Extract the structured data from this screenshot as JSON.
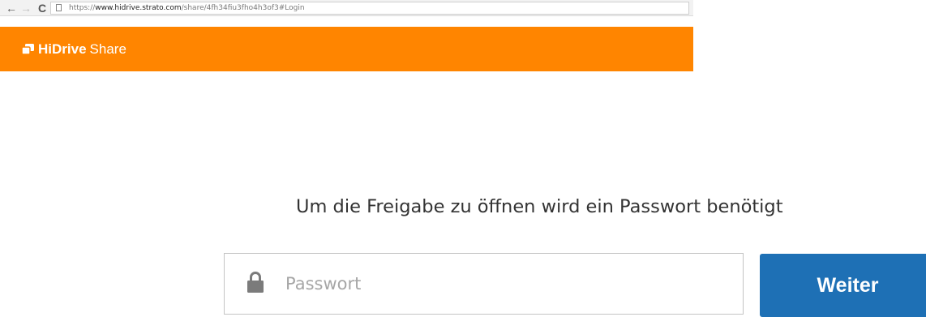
{
  "browser": {
    "back_icon": "arrow-left-icon",
    "forward_icon": "arrow-right-icon",
    "reload_icon": "reload-icon",
    "back_glyph": "←",
    "forward_glyph": "→",
    "reload_glyph": "C",
    "url": {
      "scheme": "https://",
      "host": "www.hidrive.strato.com",
      "path": "/share/4fh34fiu3fho4h3of3#Login"
    }
  },
  "header": {
    "brand_name": "HiDrive",
    "product_name": "Share",
    "background_color": "#ff8500",
    "logo_icon": "hidrive-logo-icon"
  },
  "login": {
    "prompt": "Um die Freigabe zu öffnen wird ein Passwort benötigt",
    "password_placeholder": "Passwort",
    "password_value": "",
    "lock_icon": "lock-icon",
    "submit_label": "Weiter",
    "submit_color": "#1e70b5"
  }
}
